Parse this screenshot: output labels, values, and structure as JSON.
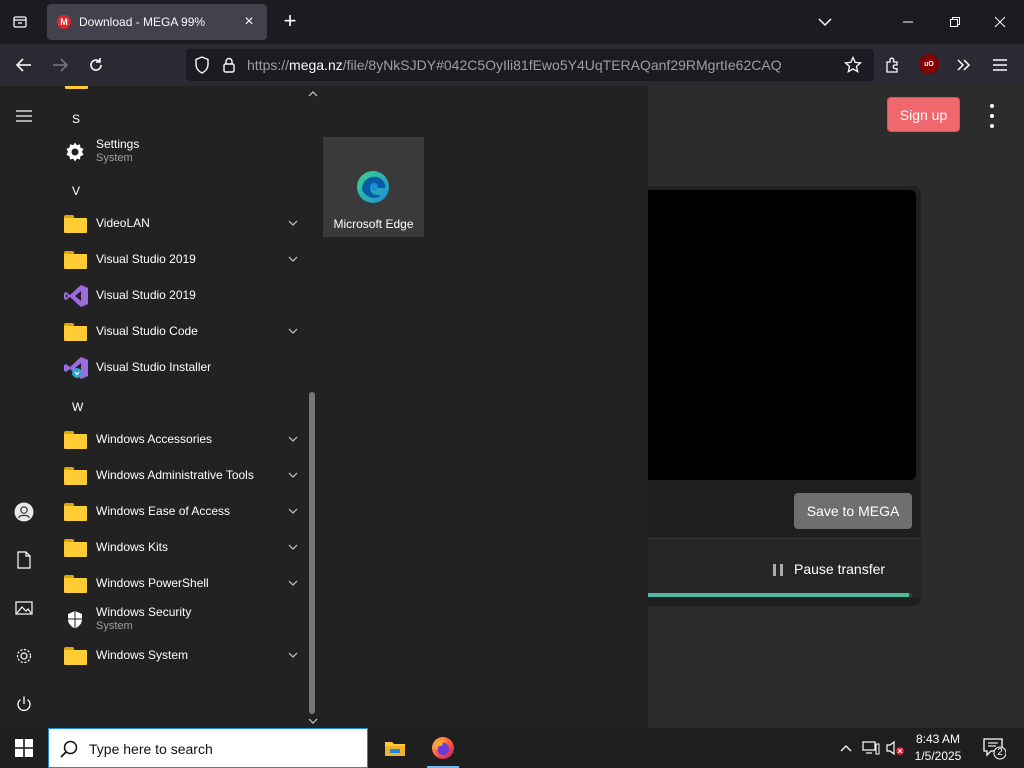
{
  "browser": {
    "tab_title": "Download - MEGA 99%",
    "favicon_letter": "M",
    "url_prefix": "https://",
    "url_domain": "mega.nz",
    "url_rest": "/file/8yNkSJDY#042C5OyIli81fEwo5Y4UqTERAQanf29RMgrtIe62CAQ",
    "ublock_badge": "uO"
  },
  "page": {
    "signup_label": "Sign up",
    "save_label": "Save to MEGA",
    "pause_label": "Pause transfer",
    "progress": 0.99,
    "accent": "#f0686e",
    "progress_color": "#4fb99f"
  },
  "start_menu": {
    "letters": {
      "s": "S",
      "v": "V",
      "w": "W"
    },
    "items": [
      {
        "label": "Settings",
        "sub": "System"
      },
      {
        "label": "VideoLAN"
      },
      {
        "label": "Visual Studio 2019"
      },
      {
        "label": "Visual Studio 2019"
      },
      {
        "label": "Visual Studio Code"
      },
      {
        "label": "Visual Studio Installer"
      },
      {
        "label": "Windows Accessories"
      },
      {
        "label": "Windows Administrative Tools"
      },
      {
        "label": "Windows Ease of Access"
      },
      {
        "label": "Windows Kits"
      },
      {
        "label": "Windows PowerShell"
      },
      {
        "label": "Windows Security",
        "sub": "System"
      },
      {
        "label": "Windows System"
      }
    ],
    "tile_label": "Microsoft Edge"
  },
  "taskbar": {
    "search_placeholder": "Type here to search",
    "time": "8:43 AM",
    "date": "1/5/2025",
    "notification_count": "2"
  }
}
